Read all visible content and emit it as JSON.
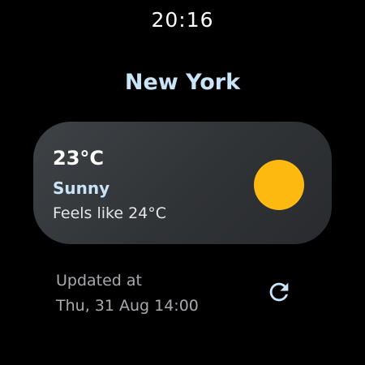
{
  "status_bar": {
    "time": "20:16"
  },
  "location": {
    "city": "New York"
  },
  "weather": {
    "temperature": "23°C",
    "condition": "Sunny",
    "feels_like": "Feels like 24°C",
    "icon": "sun-icon"
  },
  "update": {
    "label": "Updated at",
    "timestamp": "Thu, 31 Aug 14:00",
    "refresh_icon": "refresh-icon"
  },
  "colors": {
    "background": "#000000",
    "accent": "#c9e3f7",
    "sun": "#fdb90f",
    "card": "#35383b",
    "muted_text": "#a7a9ad"
  }
}
